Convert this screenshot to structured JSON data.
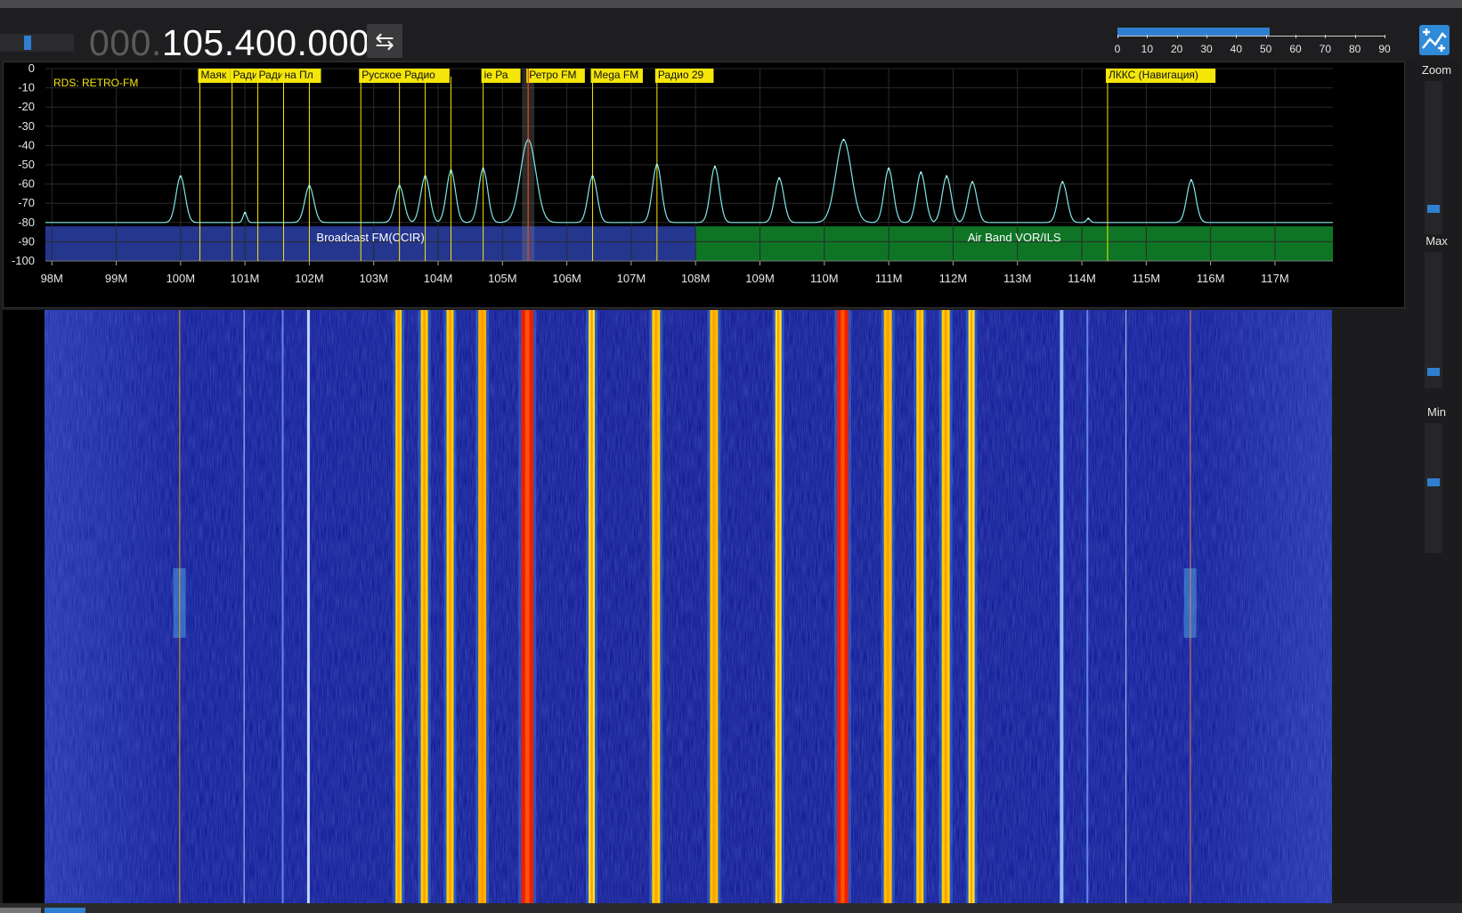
{
  "toolbar": {
    "frequency_leading": "000.",
    "frequency_main": "105.400.000",
    "swap_icon": "⇆",
    "snr_labels": [
      "0",
      "10",
      "20",
      "30",
      "40",
      "50",
      "60",
      "70",
      "80",
      "90"
    ],
    "snr_level_fraction": 0.57,
    "volume_fraction": 0.35
  },
  "side_panel": {
    "zoom_label": "Zoom",
    "max_label": "Max",
    "min_label": "Min",
    "zoom_fraction": 0.15,
    "max_fraction": 0.1,
    "min_fraction": 0.55
  },
  "spectrum": {
    "rds_text": "RDS: RETRO-FM",
    "y_axis": [
      0,
      -10,
      -20,
      -30,
      -40,
      -50,
      -60,
      -70,
      -80,
      -90,
      -100
    ],
    "freq_range_mhz": [
      97.9,
      117.9
    ],
    "tuned_freq_mhz": 105.4,
    "noise_floor_db": -80,
    "x_ticks": [
      {
        "mhz": 98,
        "label": "98M"
      },
      {
        "mhz": 99,
        "label": "99M"
      },
      {
        "mhz": 100,
        "label": "100M"
      },
      {
        "mhz": 101,
        "label": "101M"
      },
      {
        "mhz": 102,
        "label": "102M"
      },
      {
        "mhz": 103,
        "label": "103M"
      },
      {
        "mhz": 104,
        "label": "104M"
      },
      {
        "mhz": 105,
        "label": "105M"
      },
      {
        "mhz": 106,
        "label": "106M"
      },
      {
        "mhz": 107,
        "label": "107M"
      },
      {
        "mhz": 108,
        "label": "108M"
      },
      {
        "mhz": 109,
        "label": "109M"
      },
      {
        "mhz": 110,
        "label": "110M"
      },
      {
        "mhz": 111,
        "label": "111M"
      },
      {
        "mhz": 112,
        "label": "112M"
      },
      {
        "mhz": 113,
        "label": "113M"
      },
      {
        "mhz": 114,
        "label": "114M"
      },
      {
        "mhz": 115,
        "label": "115M"
      },
      {
        "mhz": 116,
        "label": "116M"
      },
      {
        "mhz": 117,
        "label": "117M"
      }
    ],
    "bands": [
      {
        "label": "Broadcast FM(CCIR)",
        "start_mhz": 97.9,
        "end_mhz": 108.0,
        "color": "#2b3fa8"
      },
      {
        "label": "Air Band VOR/ILS",
        "start_mhz": 108.0,
        "end_mhz": 117.9,
        "color": "#118a2c"
      }
    ],
    "bookmarks": [
      {
        "label": "Маяк",
        "mhz": 100.3
      },
      {
        "label": "Радио Д",
        "mhz": 100.8
      },
      {
        "label": "Радио России",
        "mhz": 101.2
      },
      {
        "label": "на Пл",
        "mhz": 101.6
      },
      {
        "label": "",
        "mhz": 102.0
      },
      {
        "label": "Русское Радио",
        "mhz": 102.8
      },
      {
        "label": "",
        "mhz": 103.4
      },
      {
        "label": "",
        "mhz": 103.8
      },
      {
        "label": "",
        "mhz": 104.2
      },
      {
        "label": "ie Ра",
        "mhz": 104.7
      },
      {
        "label": "Ретро FM",
        "mhz": 105.4
      },
      {
        "label": "Mega FM",
        "mhz": 106.4
      },
      {
        "label": "Радио 29",
        "mhz": 107.4
      },
      {
        "label": "ЛККС (Навигация)",
        "mhz": 114.4
      }
    ],
    "peaks": [
      {
        "mhz": 100.0,
        "db": -56
      },
      {
        "mhz": 101.0,
        "db": -75
      },
      {
        "mhz": 102.0,
        "db": -61
      },
      {
        "mhz": 103.4,
        "db": -61
      },
      {
        "mhz": 103.8,
        "db": -56
      },
      {
        "mhz": 104.2,
        "db": -53
      },
      {
        "mhz": 104.7,
        "db": -52
      },
      {
        "mhz": 105.4,
        "db": -37
      },
      {
        "mhz": 106.4,
        "db": -56
      },
      {
        "mhz": 107.4,
        "db": -50
      },
      {
        "mhz": 108.3,
        "db": -51
      },
      {
        "mhz": 109.3,
        "db": -57
      },
      {
        "mhz": 110.3,
        "db": -37
      },
      {
        "mhz": 111.0,
        "db": -52
      },
      {
        "mhz": 111.5,
        "db": -54
      },
      {
        "mhz": 111.9,
        "db": -56
      },
      {
        "mhz": 112.3,
        "db": -59
      },
      {
        "mhz": 113.7,
        "db": -59
      },
      {
        "mhz": 114.1,
        "db": -78
      },
      {
        "mhz": 115.7,
        "db": -58
      }
    ]
  },
  "waterfall": {
    "traces": [
      {
        "mhz": 100.0,
        "color": "#ffa500",
        "w": 1
      },
      {
        "mhz": 101.0,
        "color": "#c8e0ff",
        "w": 1
      },
      {
        "mhz": 101.6,
        "color": "#6c8ff0",
        "w": 2
      },
      {
        "mhz": 102.0,
        "color": "#d6e8ff",
        "w": 3
      },
      {
        "mhz": 103.4,
        "color": "#ffcf00",
        "w": 7
      },
      {
        "mhz": 103.8,
        "color": "#ffcf00",
        "w": 8
      },
      {
        "mhz": 104.2,
        "color": "#ffcf00",
        "w": 8
      },
      {
        "mhz": 104.7,
        "color": "#ffb000",
        "w": 9
      },
      {
        "mhz": 105.4,
        "color": "#e8200a",
        "w": 14
      },
      {
        "mhz": 106.4,
        "color": "#ffdf30",
        "w": 7
      },
      {
        "mhz": 107.4,
        "color": "#ffcf00",
        "w": 9
      },
      {
        "mhz": 108.3,
        "color": "#ffbf00",
        "w": 9
      },
      {
        "mhz": 109.3,
        "color": "#ffdf30",
        "w": 7
      },
      {
        "mhz": 110.3,
        "color": "#e8200a",
        "w": 13
      },
      {
        "mhz": 111.0,
        "color": "#ffbf00",
        "w": 9
      },
      {
        "mhz": 111.5,
        "color": "#ffcf00",
        "w": 8
      },
      {
        "mhz": 111.9,
        "color": "#ffcf00",
        "w": 9
      },
      {
        "mhz": 112.3,
        "color": "#ffdf30",
        "w": 7
      },
      {
        "mhz": 113.7,
        "color": "#9ecaff",
        "w": 4
      },
      {
        "mhz": 114.1,
        "color": "#6c8ff0",
        "w": 2
      },
      {
        "mhz": 114.7,
        "color": "#c8e0ff",
        "w": 1
      },
      {
        "mhz": 115.7,
        "color": "#ff8a40",
        "w": 1
      }
    ]
  }
}
